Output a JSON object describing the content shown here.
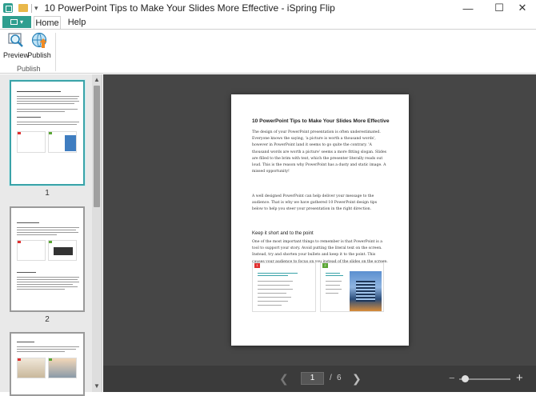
{
  "window": {
    "title": "10 PowerPoint Tips to Make Your Slides More Effective - iSpring Flip"
  },
  "window_controls": {
    "minimize": "—",
    "maximize": "☐",
    "close": "✕"
  },
  "ribbon": {
    "tabs": [
      {
        "label": "Home"
      },
      {
        "label": "Help"
      }
    ],
    "buttons": [
      {
        "label": "Preview",
        "icon": "preview-icon"
      },
      {
        "label": "Publish",
        "icon": "publish-icon"
      }
    ],
    "group_label": "Publish"
  },
  "thumbnails": [
    {
      "number": "1"
    },
    {
      "number": "2"
    }
  ],
  "document": {
    "title": "10 PowerPoint Tips to Make Your Slides More Effective",
    "para1": "The design of your PowerPoint presentation is often underestimated. Everyone knows the saying, 'a picture is worth a thousand words', however in PowerPoint land it seems to go quite the contrary. 'A thousand words are worth a picture' seems a more fitting slogan. Slides are filled to the brim with text, which the presenter literally reads out loud. This is the reason why PowerPoint has a dusty and static image. A missed opportunity!",
    "para2": "A well designed PowerPoint can help deliver your message to the audience. That is why we have gathered 10 PowerPoint design tips below to help you steer your presentation in the right direction.",
    "heading": "Keep it short and to the point",
    "para3": "One of the most important things to remember is that PowerPoint is a tool to support your story. Avoid putting the literal text on the screen. Instead, try and shorten your bullets and keep it to the point. This causes your audience to focus on you instead of the slides on the screen.",
    "fig1_tag": "1",
    "fig2_tag": "2"
  },
  "navigation": {
    "current_page": "1",
    "separator": "/",
    "total_pages": "6",
    "prev": "❮",
    "next": "❯",
    "zoom_out": "−",
    "zoom_in": "+"
  },
  "colors": {
    "accent": "#2f9e8f",
    "selected_thumb": "#3aa3a8",
    "canvas": "#464646"
  }
}
